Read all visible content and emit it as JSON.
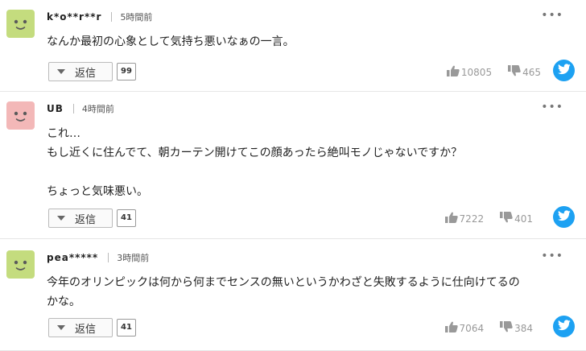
{
  "comments": [
    {
      "user": "k*o**r**r",
      "time": "5時間前",
      "lines": [
        "なんか最初の心象として気持ち悪いなぁの一言。"
      ],
      "reply_label": "返信",
      "reply_count": "99",
      "likes": "10805",
      "dislikes": "465",
      "avatar_color": "#c4dc7e"
    },
    {
      "user": "UB",
      "time": "4時間前",
      "lines": [
        "これ…",
        "もし近くに住んでて、朝カーテン開けてこの顔あったら絶叫モノじゃないですか？",
        "",
        "ちょっと気味悪い。"
      ],
      "reply_label": "返信",
      "reply_count": "41",
      "likes": "7222",
      "dislikes": "401",
      "avatar_color": "#f3b8b8"
    },
    {
      "user": "pea*****",
      "time": "3時間前",
      "lines": [
        "今年のオリンピックは何から何までセンスの無いというかわざと失敗するように仕向けてるの",
        "かな。"
      ],
      "reply_label": "返信",
      "reply_count": "41",
      "likes": "7064",
      "dislikes": "384",
      "avatar_color": "#c4dc7e"
    }
  ],
  "icons": {
    "more": "more-icon",
    "thumbs_up": "thumbs-up-icon",
    "thumbs_down": "thumbs-down-icon",
    "share": "twitter-icon",
    "twitter_color": "#1da1f2"
  }
}
